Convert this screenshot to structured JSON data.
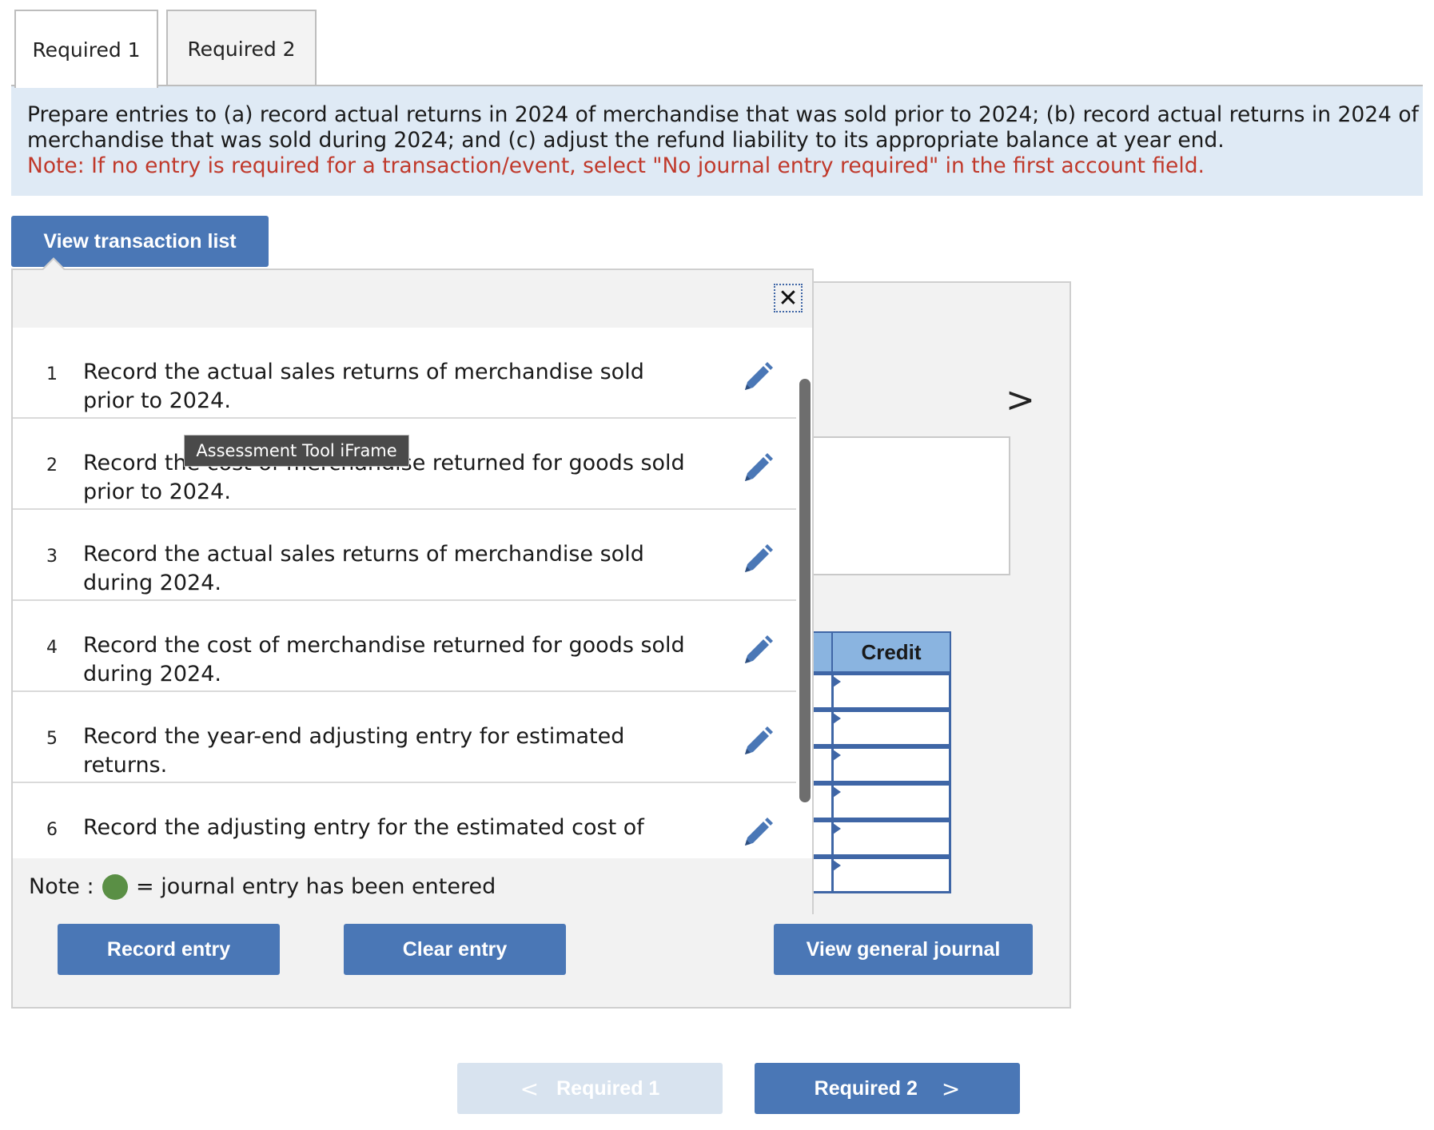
{
  "tabs": [
    {
      "label": "Required 1",
      "active": true
    },
    {
      "label": "Required 2",
      "active": false
    }
  ],
  "instructions": {
    "line1": "Prepare entries to (a) record actual returns in 2024 of merchandise that was sold prior to 2024; (b) record actual returns in 2024 of",
    "line2": "merchandise that was sold during 2024; and (c) adjust the refund liability to its appropriate balance at year end.",
    "note": "Note: If no entry is required for a transaction/event, select \"No journal entry required\" in the first account field."
  },
  "view_transaction_list_label": "View transaction list",
  "popup": {
    "close_glyph": "✕",
    "tooltip": "Assessment Tool iFrame",
    "transactions": [
      {
        "num": "1",
        "text": "Record the actual sales returns of merchandise sold prior to 2024."
      },
      {
        "num": "2",
        "text": "Record the cost of merchandise returned for goods sold prior to 2024."
      },
      {
        "num": "3",
        "text": "Record the actual sales returns of merchandise sold during 2024."
      },
      {
        "num": "4",
        "text": "Record the cost of merchandise returned for goods sold during 2024."
      },
      {
        "num": "5",
        "text": "Record the year-end adjusting entry for estimated returns."
      },
      {
        "num": "6",
        "text": "Record the adjusting entry for the estimated cost of"
      }
    ],
    "note_label": "Note :",
    "note_legend": "= journal entry has been entered"
  },
  "journal": {
    "next_glyph": ">",
    "credit_header": "Credit"
  },
  "actions": {
    "record_entry": "Record entry",
    "clear_entry": "Clear entry",
    "view_general_journal": "View general journal"
  },
  "nav": {
    "prev_label": "Required 1",
    "next_label": "Required 2",
    "prev_glyph": "<",
    "next_glyph": ">"
  },
  "colors": {
    "primary_button": "#4a77b6",
    "instruction_bg": "#dfeaf5",
    "note_red": "#c0392b",
    "entered_dot": "#5a8f45",
    "credit_header_bg": "#8ab4e0"
  }
}
